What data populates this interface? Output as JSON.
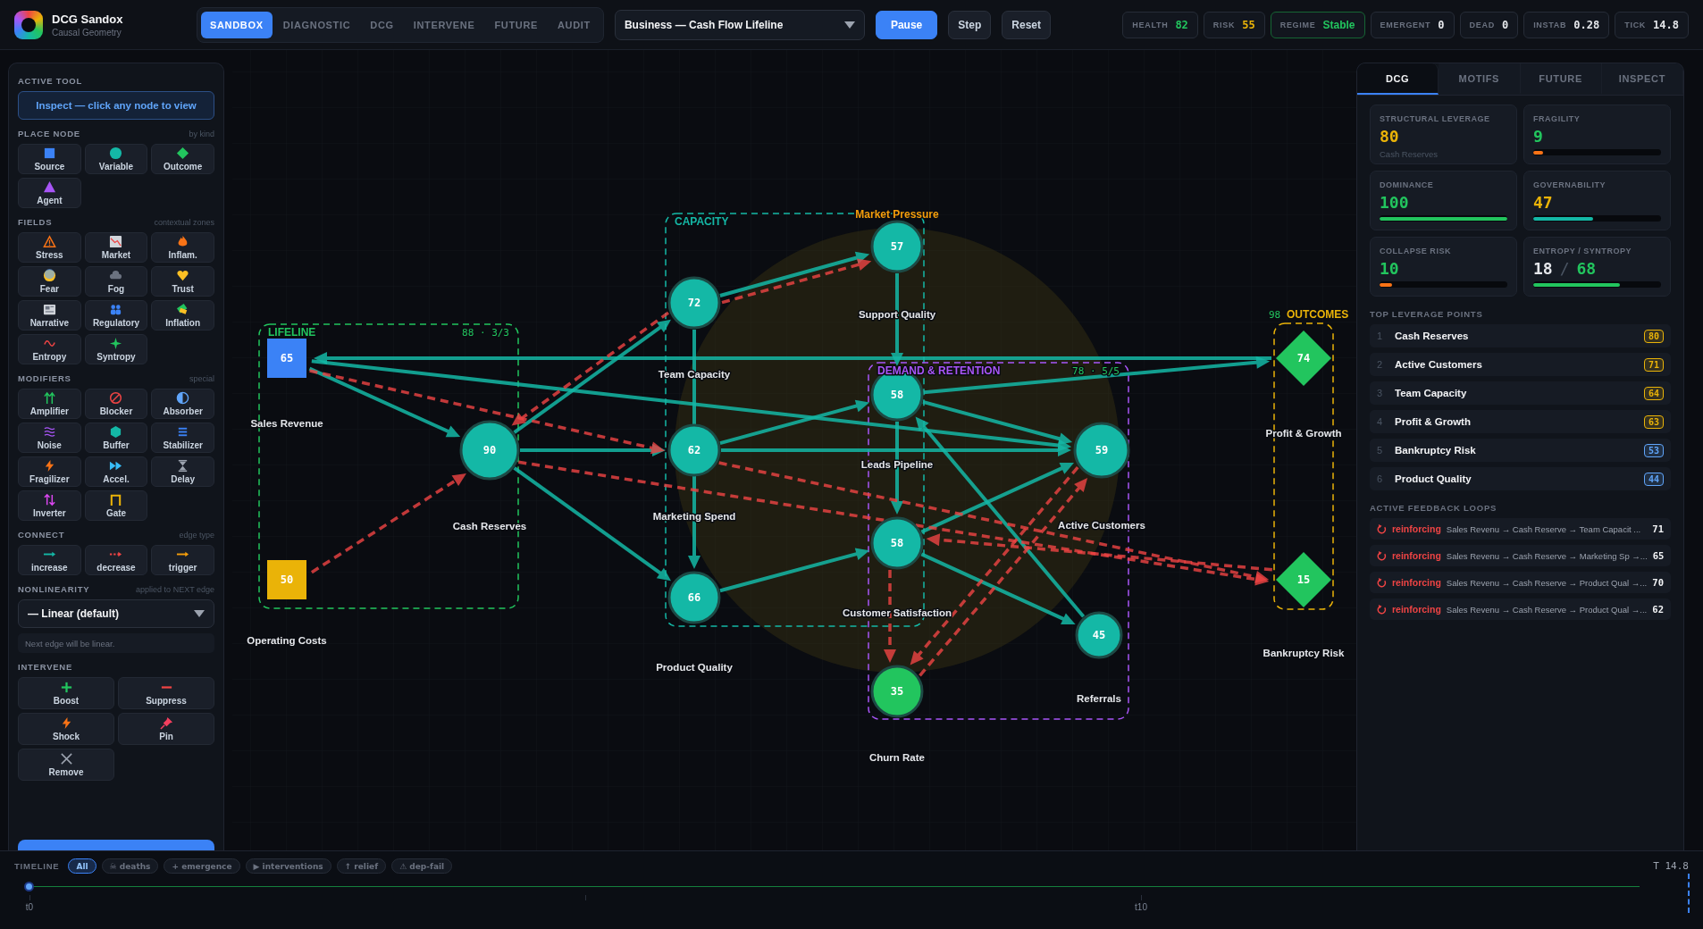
{
  "app": {
    "title": "DCG Sandox",
    "subtitle": "Causal Geometry"
  },
  "tabs": [
    {
      "label": "SANDBOX",
      "selected": true
    },
    {
      "label": "DIAGNOSTIC",
      "selected": false
    },
    {
      "label": "DCG",
      "selected": false
    },
    {
      "label": "INTERVENE",
      "selected": false
    },
    {
      "label": "FUTURE",
      "selected": false
    },
    {
      "label": "AUDIT",
      "selected": false
    }
  ],
  "scenario": {
    "value": "Business — Cash Flow Lifeline"
  },
  "controls": [
    {
      "label": "Pause",
      "kind": "primary"
    },
    {
      "label": "Step",
      "kind": "secondary"
    },
    {
      "label": "Reset",
      "kind": "secondary"
    }
  ],
  "stats": [
    {
      "label": "HEALTH",
      "value": "82",
      "color": "#22c55e",
      "highlighted": false
    },
    {
      "label": "RISK",
      "value": "55",
      "color": "#eab308",
      "highlighted": false
    },
    {
      "label": "REGIME",
      "value": "Stable",
      "color": "#22c55e",
      "highlighted": true
    },
    {
      "label": "EMERGENT",
      "value": "0",
      "color": "#e5e7eb",
      "highlighted": false
    },
    {
      "label": "DEAD",
      "value": "0",
      "color": "#e5e7eb",
      "highlighted": false
    },
    {
      "label": "INSTAB",
      "value": "0.28",
      "color": "#e5e7eb",
      "highlighted": false
    },
    {
      "label": "TICK",
      "value": "14.8",
      "color": "#e5e7eb",
      "highlighted": false
    }
  ],
  "tools": {
    "active_tool": {
      "title": "ACTIVE TOOL",
      "button": "Inspect — click any node to view"
    },
    "place_node": {
      "title": "PLACE NODE",
      "hint": "by kind",
      "items": [
        "Source",
        "Variable",
        "Outcome",
        "Agent"
      ]
    },
    "fields": {
      "title": "FIELDS",
      "hint": "contextual zones",
      "items": [
        "Stress",
        "Market",
        "Inflam.",
        "Fear",
        "Fog",
        "Trust",
        "Narrative",
        "Regulatory",
        "Inflation",
        "Entropy",
        "Syntropy"
      ]
    },
    "modifiers": {
      "title": "MODIFIERS",
      "hint": "special",
      "items": [
        "Amplifier",
        "Blocker",
        "Absorber",
        "Noise",
        "Buffer",
        "Stabilizer",
        "Fragilizer",
        "Accel.",
        "Delay",
        "Inverter",
        "Gate"
      ]
    },
    "connect": {
      "title": "CONNECT",
      "hint": "edge type",
      "items": [
        "increase",
        "decrease",
        "trigger"
      ]
    },
    "nonlinearity": {
      "title": "NONLINEARITY",
      "hint": "applied to NEXT edge",
      "value": "— Linear (default)",
      "note": "Next edge will be linear."
    },
    "intervene": {
      "title": "INTERVENE",
      "items": [
        "Boost",
        "Suppress",
        "Shock",
        "Pin",
        "Remove"
      ]
    }
  },
  "graph": {
    "fields": [
      {
        "label": "Market Pressure"
      }
    ],
    "zones": [
      {
        "label": "LIFELINE",
        "stat": "88 · 3/3",
        "color": "#22c55e"
      },
      {
        "label": "CAPACITY",
        "color": "#14b8a6"
      },
      {
        "label": "DEMAND & RETENTION",
        "stat": "78 · 5/5",
        "color": "#a855f7"
      },
      {
        "label": "OUTCOMES",
        "stat": "98",
        "color": "#eab308"
      }
    ],
    "nodes": [
      {
        "label": "Sales Revenue",
        "value": "65",
        "kind": "source",
        "color": "#3b82f6"
      },
      {
        "label": "Operating Costs",
        "value": "50",
        "kind": "source",
        "color": "#eab308"
      },
      {
        "label": "Cash Reserves",
        "value": "90",
        "kind": "variable",
        "color": "#14b8a6"
      },
      {
        "label": "Team Capacity",
        "value": "72",
        "kind": "variable",
        "color": "#14b8a6"
      },
      {
        "label": "Marketing Spend",
        "value": "62",
        "kind": "variable",
        "color": "#14b8a6"
      },
      {
        "label": "Product Quality",
        "value": "66",
        "kind": "variable",
        "color": "#14b8a6"
      },
      {
        "label": "Support Quality",
        "value": "57",
        "kind": "variable",
        "color": "#14b8a6"
      },
      {
        "label": "Leads Pipeline",
        "value": "58",
        "kind": "variable",
        "color": "#14b8a6"
      },
      {
        "label": "Customer Satisfaction",
        "value": "58",
        "kind": "variable",
        "color": "#14b8a6"
      },
      {
        "label": "Churn Rate",
        "value": "35",
        "kind": "variable",
        "color": "#22c55e"
      },
      {
        "label": "Active Customers",
        "value": "59",
        "kind": "variable",
        "color": "#14b8a6"
      },
      {
        "label": "Referrals",
        "value": "45",
        "kind": "variable",
        "color": "#14b8a6"
      },
      {
        "label": "Profit & Growth",
        "value": "74",
        "kind": "outcome",
        "color": "#22c55e"
      },
      {
        "label": "Bankruptcy Risk",
        "value": "15",
        "kind": "outcome",
        "color": "#22c55e"
      }
    ]
  },
  "inspector": {
    "tabs": [
      {
        "label": "DCG",
        "selected": true
      },
      {
        "label": "MOTIFS",
        "selected": false
      },
      {
        "label": "FUTURE",
        "selected": false
      },
      {
        "label": "INSPECT",
        "selected": false
      }
    ],
    "metrics": [
      {
        "label": "STRUCTURAL LEVERAGE",
        "value": "80",
        "color": "#eab308",
        "sub": "Cash Reserves"
      },
      {
        "label": "FRAGILITY",
        "value": "9",
        "color": "#22c55e",
        "bar": {
          "level": 0.08,
          "color": "#f97316"
        }
      },
      {
        "label": "DOMINANCE",
        "value": "100",
        "color": "#22c55e",
        "bar": {
          "level": 1,
          "color": "#22c55e"
        }
      },
      {
        "label": "GOVERNABILITY",
        "value": "47",
        "color": "#eab308",
        "bar": {
          "level": 0.47,
          "color": "#14b8a6"
        }
      },
      {
        "label": "COLLAPSE RISK",
        "value": "10",
        "color": "#22c55e",
        "bar": {
          "level": 0.1,
          "color": "#f97316"
        }
      },
      {
        "label": "ENTROPY / SYNTROPY",
        "value": "18",
        "color": "#e5e7eb",
        "separator": "/",
        "second": {
          "value": "68",
          "color": "#22c55e"
        },
        "bar": {
          "level": 0.68,
          "color": "#22c55e"
        }
      }
    ],
    "leverage": {
      "title": "TOP LEVERAGE POINTS",
      "items": [
        {
          "rank": "1",
          "name": "Cash Reserves",
          "score": "80",
          "color": "#eab308"
        },
        {
          "rank": "2",
          "name": "Active Customers",
          "score": "71",
          "color": "#eab308"
        },
        {
          "rank": "3",
          "name": "Team Capacity",
          "score": "64",
          "color": "#eab308"
        },
        {
          "rank": "4",
          "name": "Profit & Growth",
          "score": "63",
          "color": "#eab308"
        },
        {
          "rank": "5",
          "name": "Bankruptcy Risk",
          "score": "53",
          "color": "#60a5fa"
        },
        {
          "rank": "6",
          "name": "Product Quality",
          "score": "44",
          "color": "#60a5fa"
        }
      ]
    },
    "loops": {
      "title": "ACTIVE FEEDBACK LOOPS",
      "items": [
        {
          "type": "reinforcing",
          "path": "Sales Revenu → Cash Reserve → Team Capacit ...",
          "score": "71"
        },
        {
          "type": "reinforcing",
          "path": "Sales Revenu → Cash Reserve → Marketing Sp →...",
          "score": "65"
        },
        {
          "type": "reinforcing",
          "path": "Sales Revenu → Cash Reserve → Product Qual →...",
          "score": "70"
        },
        {
          "type": "reinforcing",
          "path": "Sales Revenu → Cash Reserve → Product Qual →...",
          "score": "62"
        }
      ]
    }
  },
  "timeline": {
    "title": "TIMELINE",
    "filters": [
      {
        "label": "All",
        "selected": true
      },
      {
        "label": "☠ deaths",
        "selected": false
      },
      {
        "label": "+ emergence",
        "selected": false
      },
      {
        "label": "▶ interventions",
        "selected": false
      },
      {
        "label": "↑ relief",
        "selected": false
      },
      {
        "label": "⚠ dep-fail",
        "selected": false
      }
    ],
    "level": 0,
    "ticks": [
      "t0",
      "t10"
    ],
    "time": "T 14.8"
  }
}
